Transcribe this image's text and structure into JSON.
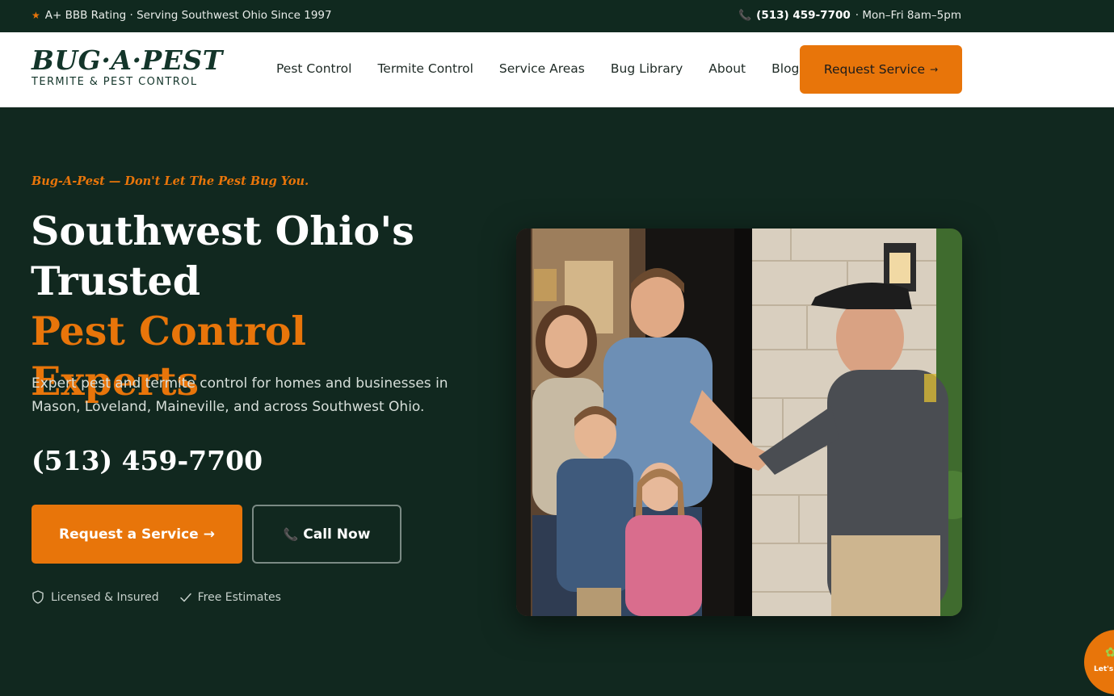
{
  "topbar": {
    "rating_text": "A+ BBB Rating · Serving Southwest Ohio Since 1997",
    "phone": "(513) 459-7700",
    "hours": "· Mon–Fri 8am–5pm"
  },
  "header": {
    "logo_main": "BUG·A·PEST",
    "logo_sub": "TERMITE & PEST CONTROL",
    "nav": [
      {
        "label": "Pest Control"
      },
      {
        "label": "Termite Control"
      },
      {
        "label": "Service Areas"
      },
      {
        "label": "Bug Library"
      },
      {
        "label": "About"
      },
      {
        "label": "Blog"
      }
    ],
    "cta_label": "Request Service",
    "cta_arrow": "→"
  },
  "hero": {
    "tagline": "Bug-A-Pest — Don't Let The Pest Bug You.",
    "title_line1": "Southwest Ohio's",
    "title_line2": "Trusted",
    "title_accent": "Pest Control Experts",
    "description": "Expert pest and termite control for homes and businesses in Mason, Loveland, Maineville, and across Southwest Ohio.",
    "phone": "(513) 459-7700",
    "primary_button": "Request a Service",
    "primary_arrow": "→",
    "secondary_button": "Call Now",
    "badges": [
      {
        "label": "Licensed & Insured",
        "icon": "shield-icon"
      },
      {
        "label": "Free Estimates",
        "icon": "check-icon"
      }
    ]
  },
  "chat": {
    "label": "Let's"
  },
  "colors": {
    "brand_dark": "#10291f",
    "accent": "#e8750a"
  }
}
